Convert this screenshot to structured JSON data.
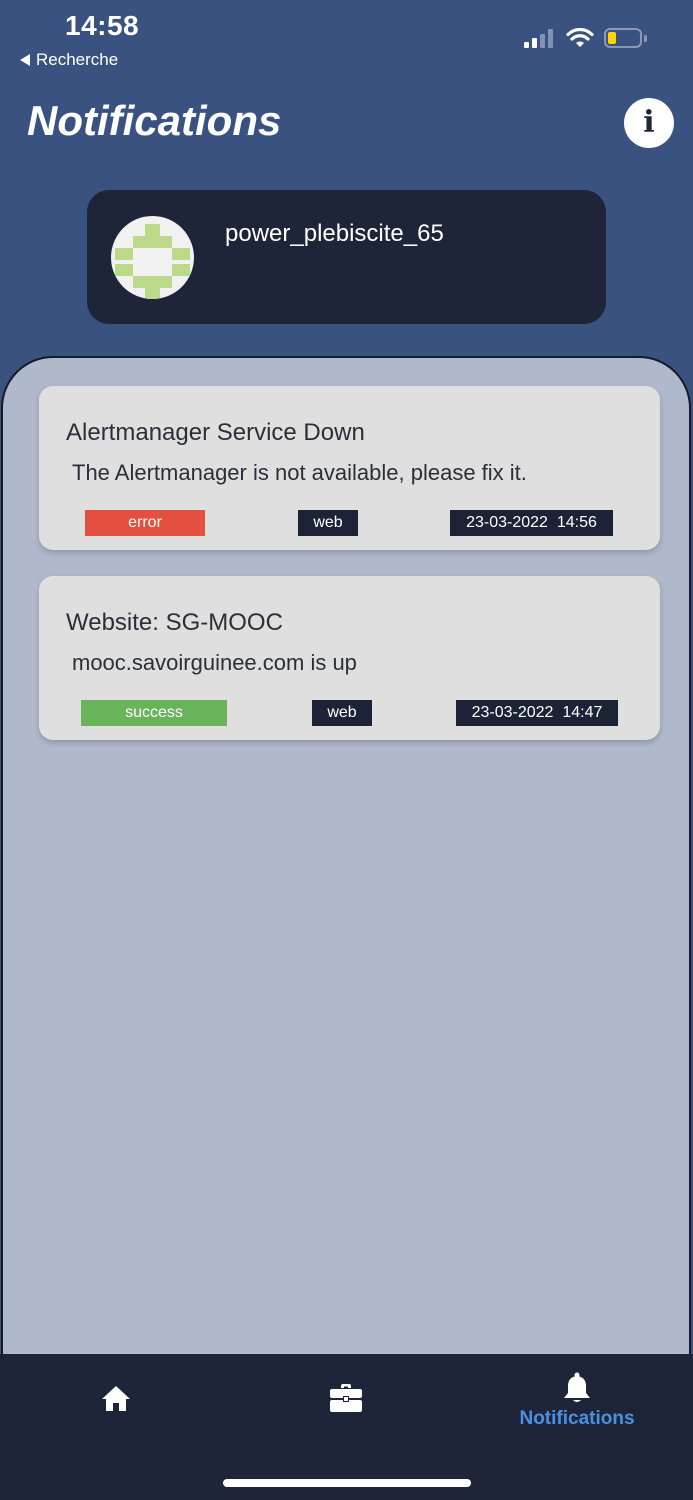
{
  "status_bar": {
    "time": "14:58",
    "back_label": "Recherche"
  },
  "header": {
    "title": "Notifications",
    "info_icon": "info-icon"
  },
  "profile": {
    "username": "power_plebiscite_65",
    "avatar_colors": {
      "fg": "#bcd98a",
      "bg": "#f1f1f1"
    }
  },
  "notifications": [
    {
      "title": "Alertmanager Service Down",
      "message": "The Alertmanager is not available, please fix it.",
      "status": "error",
      "status_color": "#e4503f",
      "source": "web",
      "timestamp": "23-03-2022  14:56"
    },
    {
      "title": "Website: SG-MOOC",
      "message": "mooc.savoirguinee.com is up",
      "status": "success",
      "status_color": "#69b45b",
      "source": "web",
      "timestamp": "23-03-2022  14:47"
    }
  ],
  "tab_bar": {
    "tabs": [
      {
        "icon": "home-icon",
        "label": ""
      },
      {
        "icon": "briefcase-icon",
        "label": ""
      },
      {
        "icon": "bell-icon",
        "label": "Notifications",
        "active": true
      }
    ],
    "active_color": "#4a90e2"
  }
}
